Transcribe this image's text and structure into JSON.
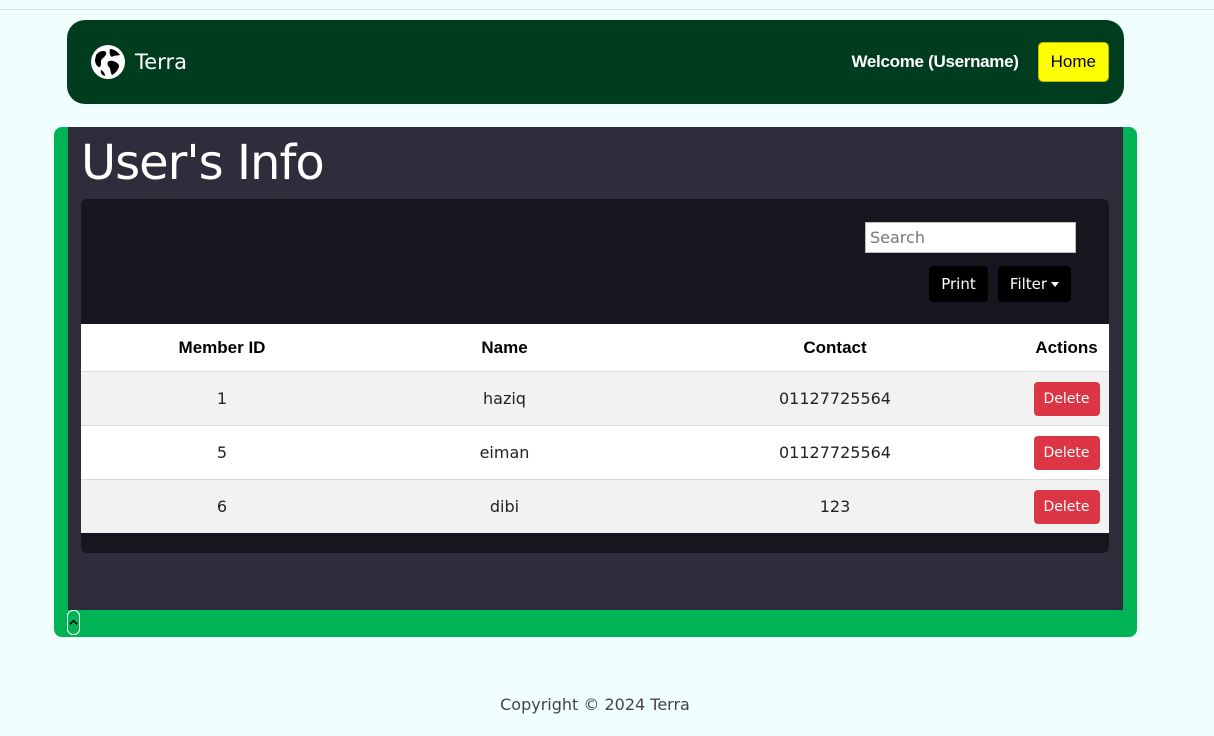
{
  "navbar": {
    "brand_name": "Terra",
    "brand_icon": "globe-icon",
    "welcome_text": "Welcome (Username)",
    "home_label": "Home"
  },
  "page": {
    "title": "User's Info"
  },
  "toolbar": {
    "search_placeholder": "Search",
    "print_label": "Print",
    "filter_label": "Filter"
  },
  "table": {
    "headers": [
      "Member ID",
      "Name",
      "Contact",
      "Actions"
    ],
    "rows": [
      {
        "id": "1",
        "name": "haziq",
        "contact": "01127725564",
        "action": "Delete"
      },
      {
        "id": "5",
        "name": "eiman",
        "contact": "01127725564",
        "action": "Delete"
      },
      {
        "id": "6",
        "name": "dibi",
        "contact": "123",
        "action": "Delete"
      }
    ]
  },
  "footer": {
    "copyright": "Copyright © 2024 Terra"
  },
  "colors": {
    "navbar_bg": "#003d1f",
    "frame_green": "#00b456",
    "panel_bg": "#2d2d3c",
    "card_bg": "#16171e",
    "home_yellow": "#ffff00",
    "delete_red": "#dc3545"
  }
}
